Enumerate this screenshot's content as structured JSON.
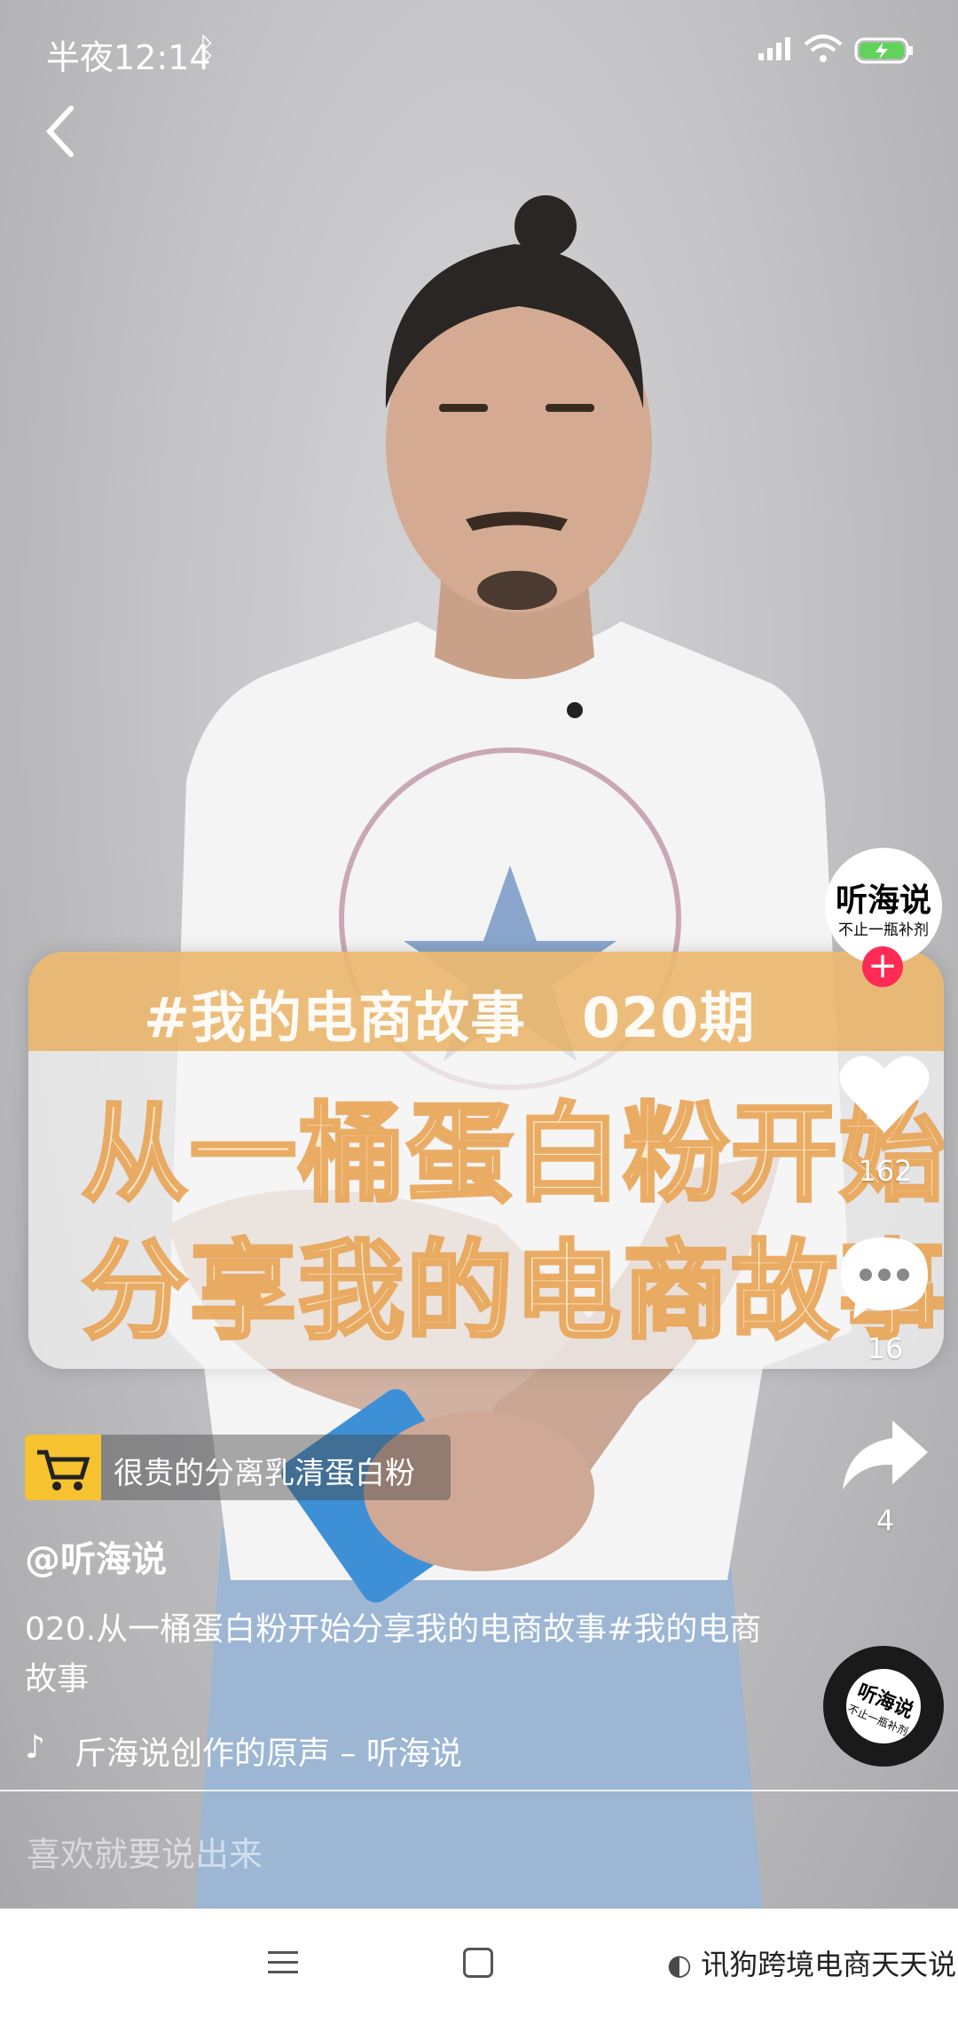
{
  "status_bar": {
    "time": "半夜12:14",
    "icons": [
      "bluetooth-icon",
      "signal-icon",
      "wifi-icon",
      "battery-charging-icon"
    ]
  },
  "video": {
    "title_banner": "#我的电商故事　020期",
    "title_line1": "从一桶蛋白粉开始",
    "title_line2": "分享我的电商故事"
  },
  "sidebar": {
    "avatar_name": "听海说",
    "avatar_sub": "不止一瓶补剂",
    "follow": "+",
    "likes": "162",
    "comments": "16",
    "shares": "4"
  },
  "product": {
    "label": "很贵的分离乳清蛋白粉"
  },
  "author": {
    "handle": "@听海说"
  },
  "description": "020.从一桶蛋白粉开始分享我的电商故事#我的电商故事",
  "music": {
    "text": "斤海说创作的原声 – 听海说"
  },
  "disc": {
    "label": "听海说",
    "sub": "不止一瓶补剂"
  },
  "comment_input": {
    "placeholder": "喜欢就要说出来"
  },
  "nav": {
    "watermark": "讯狗跨境电商天天说"
  },
  "colors": {
    "follow": "#fe2c55",
    "cart": "#f6c230",
    "banner": "#e8aa50"
  }
}
